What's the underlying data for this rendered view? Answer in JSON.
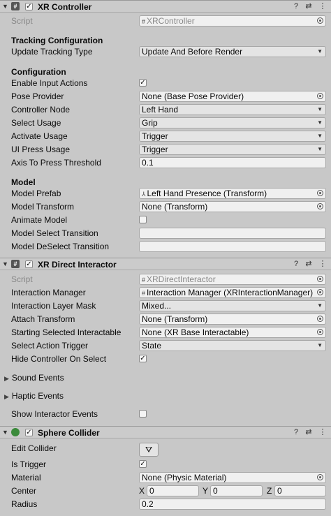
{
  "xr_controller": {
    "title": "XR Controller",
    "script_label": "Script",
    "script_value": "XRController",
    "tracking_section": "Tracking Configuration",
    "update_tracking_label": "Update Tracking Type",
    "update_tracking_value": "Update And Before Render",
    "config_section": "Configuration",
    "enable_input_label": "Enable Input Actions",
    "enable_input_checked": true,
    "pose_provider_label": "Pose Provider",
    "pose_provider_value": "None (Base Pose Provider)",
    "controller_node_label": "Controller Node",
    "controller_node_value": "Left Hand",
    "select_usage_label": "Select Usage",
    "select_usage_value": "Grip",
    "activate_usage_label": "Activate Usage",
    "activate_usage_value": "Trigger",
    "ui_press_label": "UI Press Usage",
    "ui_press_value": "Trigger",
    "axis_threshold_label": "Axis To Press Threshold",
    "axis_threshold_value": "0.1",
    "model_section": "Model",
    "model_prefab_label": "Model Prefab",
    "model_prefab_value": "Left Hand Presence (Transform)",
    "model_transform_label": "Model Transform",
    "model_transform_value": "None (Transform)",
    "animate_model_label": "Animate Model",
    "animate_model_checked": false,
    "model_select_transition_label": "Model Select Transition",
    "model_select_transition_value": "",
    "model_deselect_transition_label": "Model DeSelect Transition",
    "model_deselect_transition_value": ""
  },
  "xr_direct": {
    "title": "XR Direct Interactor",
    "script_label": "Script",
    "script_value": "XRDirectInteractor",
    "interaction_manager_label": "Interaction Manager",
    "interaction_manager_value": "Interaction Manager (XRInteractionManager)",
    "layer_mask_label": "Interaction Layer Mask",
    "layer_mask_value": "Mixed...",
    "attach_transform_label": "Attach Transform",
    "attach_transform_value": "None (Transform)",
    "starting_selected_label": "Starting Selected Interactable",
    "starting_selected_value": "None (XR Base Interactable)",
    "select_action_label": "Select Action Trigger",
    "select_action_value": "State",
    "hide_controller_label": "Hide Controller On Select",
    "hide_controller_checked": true,
    "sound_events_label": "Sound Events",
    "haptic_events_label": "Haptic Events",
    "show_events_label": "Show Interactor Events",
    "show_events_checked": false
  },
  "sphere_collider": {
    "title": "Sphere Collider",
    "edit_collider_label": "Edit Collider",
    "is_trigger_label": "Is Trigger",
    "is_trigger_checked": true,
    "material_label": "Material",
    "material_value": "None (Physic Material)",
    "center_label": "Center",
    "center_x_label": "X",
    "center_x": "0",
    "center_y_label": "Y",
    "center_y": "0",
    "center_z_label": "Z",
    "center_z": "0",
    "radius_label": "Radius",
    "radius_value": "0.2"
  },
  "glyphs": {
    "check": "✓",
    "fold_open": "▼",
    "fold_closed": "▶",
    "dropdown": "▼",
    "help": "?",
    "settings": "⇄",
    "menu": "⋮",
    "script_glyph": "#",
    "edit_collider": "⛛"
  },
  "icons": [
    "help-icon",
    "preset-settings-icon",
    "context-menu-icon",
    "object-picker-icon",
    "script-icon",
    "sphere-collider-icon",
    "edit-collider-icon"
  ]
}
